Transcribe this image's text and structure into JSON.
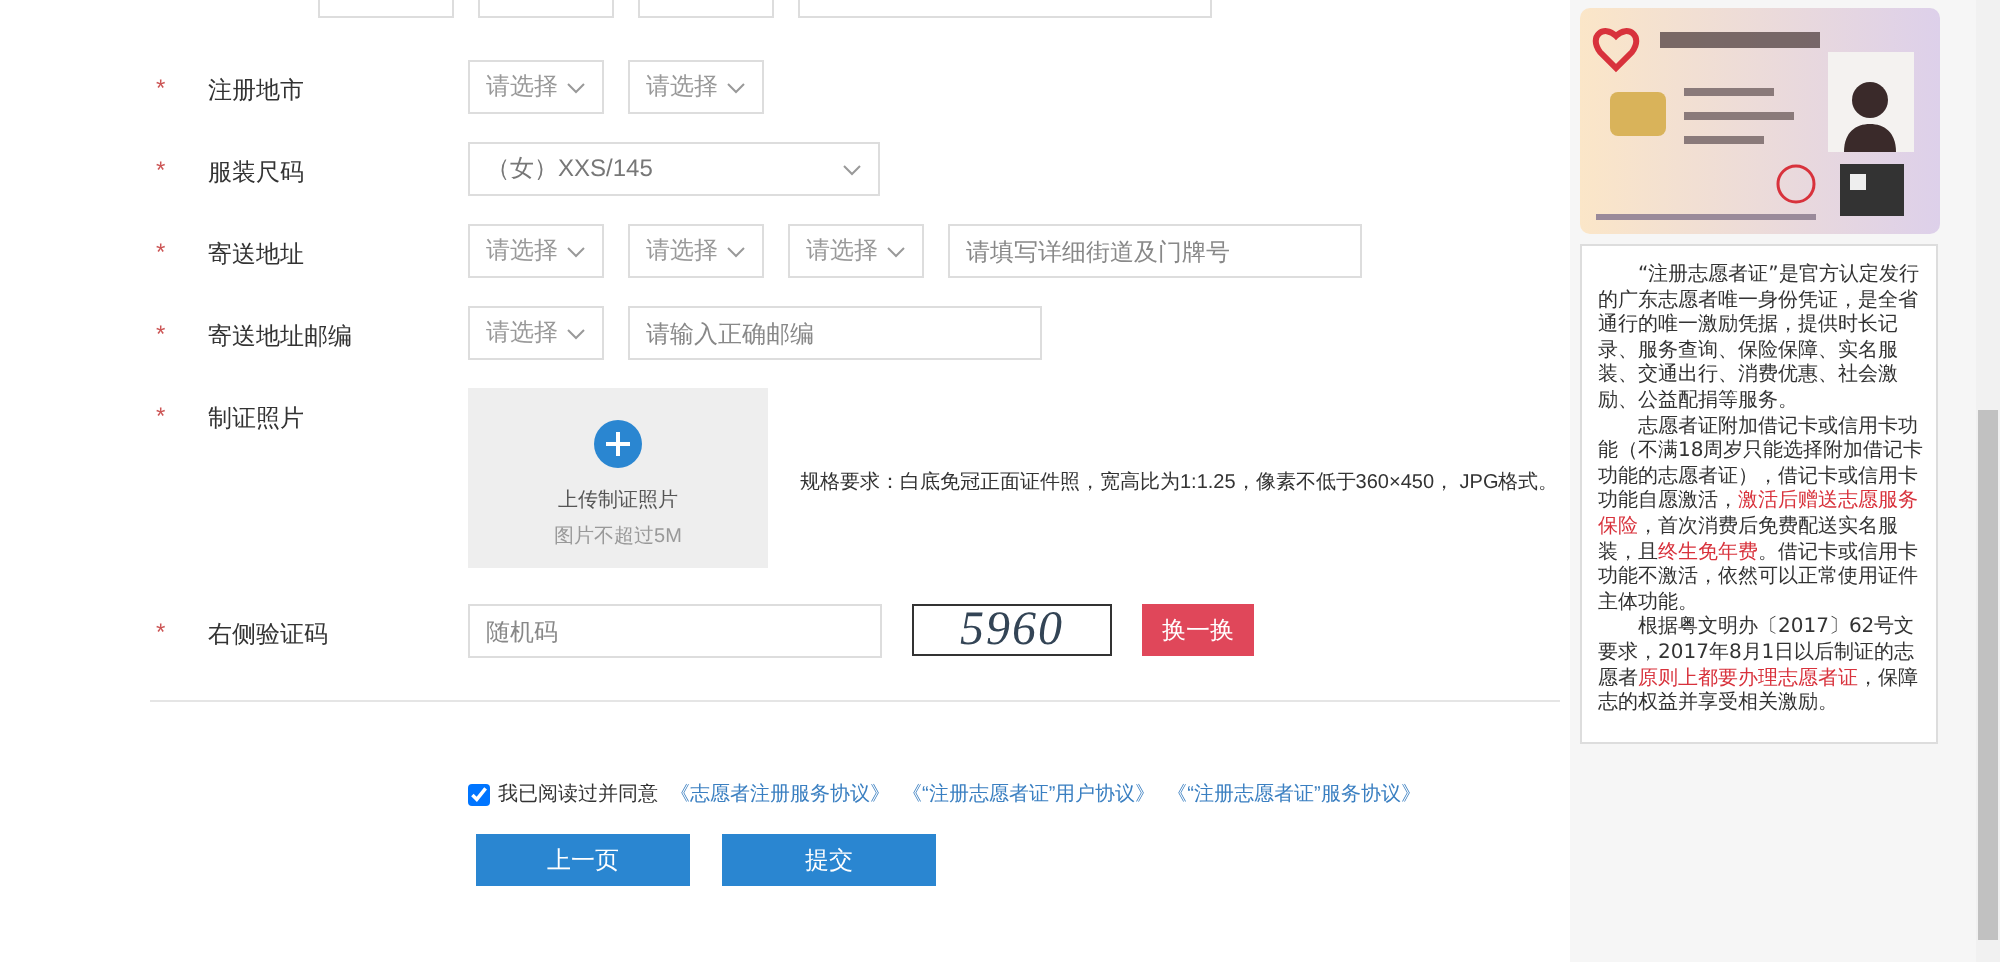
{
  "form": {
    "rows": [
      {
        "mark": "*",
        "label": "注册地市",
        "fields": [
          {
            "kind": "select",
            "placeholder": "请选择"
          },
          {
            "kind": "select",
            "placeholder": "请选择"
          }
        ]
      },
      {
        "mark": "*",
        "label": "服装尺码",
        "fields": [
          {
            "kind": "dropdown",
            "value": "（女）XXS/145"
          }
        ]
      },
      {
        "mark": "*",
        "label": "寄送地址",
        "fields": [
          {
            "kind": "select",
            "placeholder": "请选择"
          },
          {
            "kind": "select",
            "placeholder": "请选择"
          },
          {
            "kind": "select",
            "placeholder": "请选择"
          },
          {
            "kind": "input",
            "placeholder": "请填写详细街道及门牌号"
          }
        ]
      },
      {
        "mark": "*",
        "label": "寄送地址邮编",
        "fields": [
          {
            "kind": "select",
            "placeholder": "请选择"
          },
          {
            "kind": "input",
            "placeholder": "请输入正确邮编"
          }
        ]
      },
      {
        "mark": "*",
        "label": "制证照片",
        "fields": [
          {
            "kind": "upload",
            "title": "上传制证照片",
            "hint": "图片不超过5M"
          },
          {
            "kind": "note",
            "text": "规格要求：白底免冠正面证件照，宽高比为1:1.25，像素不低于360×450， JPG格式。"
          }
        ]
      },
      {
        "mark": "*",
        "label": "右侧验证码",
        "fields": [
          {
            "kind": "input",
            "placeholder": "随机码"
          },
          {
            "kind": "captcha",
            "text": "5960"
          },
          {
            "kind": "button",
            "label": "换一换"
          }
        ]
      }
    ]
  },
  "agreement": {
    "checked": true,
    "text": "我已阅读过并同意",
    "links": [
      "《志愿者注册服务协议》",
      "《“注册志愿者证”用户协议》",
      "《“注册志愿者证”服务协议》"
    ]
  },
  "buttons": [
    "上一页",
    "提交"
  ],
  "side_panel": {
    "card": {
      "kind": "picture"
    },
    "paragraphs": [
      [
        {
          "text": "“注册志愿者证”是官方认定发行的广东志愿者唯一身份凭证，是全省通行的唯一激励凭据，提供时长记录、服务查询、保险保障、实名服装、交通出行、消费优惠、社会激励、公益配捐等服务。",
          "highlight": false
        }
      ],
      [
        {
          "text": "志愿者证附加借记卡或信用卡功能（不满18周岁只能选择附加借记卡功能的志愿者证），借记卡或信用卡功能自愿激活，",
          "highlight": false
        },
        {
          "text": "激活后赠送志愿服务保险",
          "highlight": true
        },
        {
          "text": "，首次消费后免费配送实名服装，且",
          "highlight": false
        },
        {
          "text": "终生免年费",
          "highlight": true
        },
        {
          "text": "。借记卡或信用卡功能不激活，依然可以正常使用证件主体功能。",
          "highlight": false
        }
      ],
      [
        {
          "text": "根据粤文明办〔2017〕62号文要求，2017年8月1日以后制证的志愿者",
          "highlight": false
        },
        {
          "text": "原则上都要办理志愿者证",
          "highlight": true
        },
        {
          "text": "，保障志的权益并享受相关激励。",
          "highlight": false
        }
      ]
    ]
  }
}
